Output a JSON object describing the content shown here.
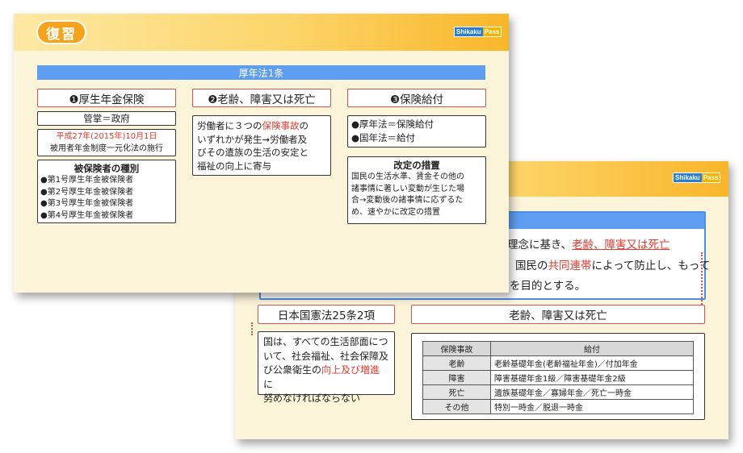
{
  "brand": {
    "part1": "Shikaku",
    "part2": "Pass"
  },
  "front": {
    "badge": "復習",
    "law_title": "厚年法1条",
    "col1": {
      "title": "❶厚生年金保険",
      "kansho": "管掌＝政府",
      "date": "平成27年(2015年)10月1日",
      "date_note": "被用者年金制度一元化法の施行",
      "insured_title": "被保険者の種別",
      "insured_items": [
        "●第1号厚生年金被保険者",
        "●第2号厚生年金被保険者",
        "●第3号厚生年金被保険者",
        "●第4号厚生年金被保険者"
      ]
    },
    "col2": {
      "title": "❷老齢、障害又は死亡",
      "body_l1_a": "労働者に３つの",
      "body_l1_red": "保険事故",
      "body_l1_b": "の",
      "body_l2": "いずれかが発生→労働者及",
      "body_l3": "びその遺族の生活の安定と",
      "body_l4": "福祉の向上に寄与"
    },
    "col3": {
      "title": "❸保険給付",
      "items": [
        "●厚年法＝保険給付",
        "●国年法＝給付"
      ],
      "revision_title": "改定の措置",
      "revision_lines": [
        "国民の生活水準、賃金その他の",
        "諸事情に著しい変動が生じた場",
        "合→変動後の諸事情に応ずるた",
        "め、速やかに改定の措置"
      ]
    }
  },
  "back": {
    "line1_a": "する理念に基き、",
    "line1_red": "老齢、障害又は死亡",
    "line2_a": "国民の",
    "line2_red": "共同連帯",
    "line2_b": "によって防止し、もって",
    "line3": "を目的とする。",
    "constitution_title": "日本国憲法25条2項",
    "constitution_lines_1": "国は、すべての生活部面につ",
    "constitution_lines_2": "いて、社会福祉、社会保障及",
    "constitution_l3_a": "び公衆衛生の",
    "constitution_l3_red": "向上及び増進",
    "constitution_l3_b": "に",
    "constitution_lines_4": "努めなければならない",
    "events_title": "老齢、障害又は死亡",
    "table": {
      "headers": [
        "保険事故",
        "給付"
      ],
      "rows": [
        [
          "老齢",
          "老齢基礎年金(老齢福祉年金)／付加年金"
        ],
        [
          "障害",
          "障害基礎年金1級／障害基礎年金2級"
        ],
        [
          "死亡",
          "遺族基礎年金／寡婦年金／死亡一時金"
        ],
        [
          "その他",
          "特別一時金／脱退一時金"
        ]
      ]
    }
  }
}
